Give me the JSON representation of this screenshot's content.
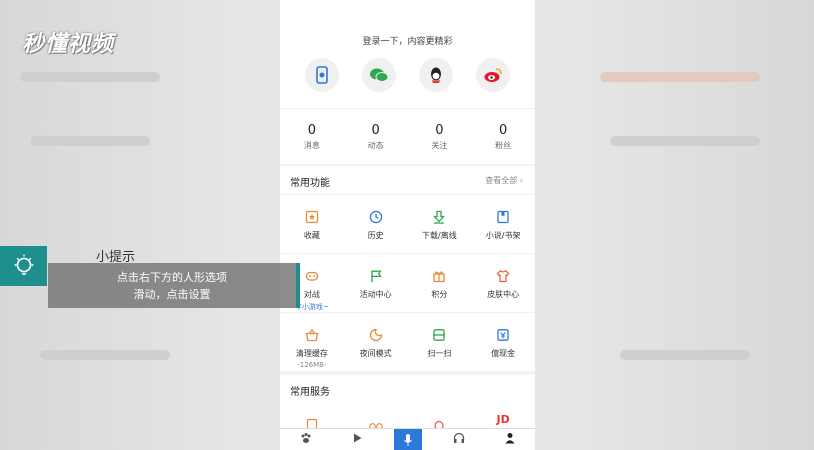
{
  "logo": "秒懂视频",
  "login": {
    "title": "登录一下，内容更精彩"
  },
  "stats": [
    {
      "num": "0",
      "label": "消息"
    },
    {
      "num": "0",
      "label": "动态"
    },
    {
      "num": "0",
      "label": "关注"
    },
    {
      "num": "0",
      "label": "粉丝"
    }
  ],
  "common_functions": {
    "title": "常用功能",
    "more": "查看全部",
    "items": [
      {
        "label": "收藏",
        "icon": "star-icon",
        "sub": ""
      },
      {
        "label": "历史",
        "icon": "clock-icon",
        "sub": ""
      },
      {
        "label": "下载/离线",
        "icon": "download-icon",
        "sub": ""
      },
      {
        "label": "小说/书架",
        "icon": "book-icon",
        "sub": ""
      },
      {
        "label": "对战",
        "icon": "gamepad-icon",
        "sub": "年小游戏~"
      },
      {
        "label": "活动中心",
        "icon": "flag-icon",
        "sub": ""
      },
      {
        "label": "积分",
        "icon": "gift-icon",
        "sub": ""
      },
      {
        "label": "皮肤中心",
        "icon": "shirt-icon",
        "sub": ""
      },
      {
        "label": "清理缓存",
        "icon": "basket-icon",
        "sub": "-126MB-"
      },
      {
        "label": "夜间模式",
        "icon": "moon-icon",
        "sub": ""
      },
      {
        "label": "扫一扫",
        "icon": "scan-icon",
        "sub": ""
      },
      {
        "label": "億现金",
        "icon": "cash-icon",
        "sub": ""
      }
    ]
  },
  "common_services": {
    "title": "常用服务"
  },
  "tip": {
    "title": "小提示",
    "line1": "点击右下方的人形选项",
    "line2": "滑动，点击设置"
  },
  "colors": {
    "accent": "#1e8f8c",
    "orange": "#e8893a",
    "blue": "#2d79d8",
    "green": "#2fa84f"
  }
}
